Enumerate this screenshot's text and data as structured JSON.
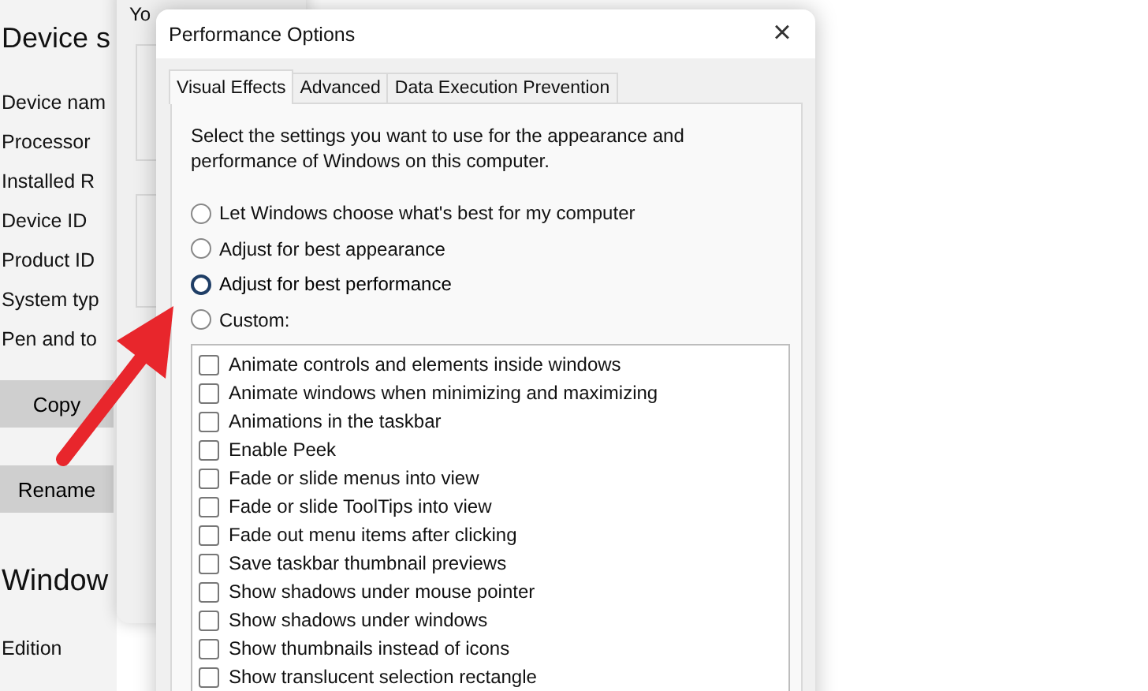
{
  "settings_page": {
    "heading": "Device s",
    "rows": [
      "Device nam",
      "Processor",
      "Installed R",
      "Device ID",
      "Product ID",
      "System typ",
      "Pen and to"
    ],
    "buttons": [
      "Copy",
      "Rename"
    ],
    "section_heading": "Window",
    "section_rows": [
      "Edition"
    ]
  },
  "background_dialog": {
    "intro": "Yo"
  },
  "dialog": {
    "title": "Performance Options",
    "close": "×",
    "tabs": [
      {
        "label": "Visual Effects",
        "selected": true
      },
      {
        "label": "Advanced",
        "selected": false
      },
      {
        "label": "Data Execution Prevention",
        "selected": false
      }
    ],
    "description": "Select the settings you want to use for the appearance and performance of Windows on this computer.",
    "options": [
      {
        "label": "Let Windows choose what's best for my computer",
        "selected": false,
        "focused": false
      },
      {
        "label": "Adjust for best appearance",
        "selected": false,
        "focused": false
      },
      {
        "label": "Adjust for best performance",
        "selected": false,
        "focused": true
      },
      {
        "label": "Custom:",
        "selected": false,
        "focused": false
      }
    ],
    "effects": [
      {
        "label": "Animate controls and elements inside windows",
        "checked": false
      },
      {
        "label": "Animate windows when minimizing and maximizing",
        "checked": false
      },
      {
        "label": "Animations in the taskbar",
        "checked": false
      },
      {
        "label": "Enable Peek",
        "checked": false
      },
      {
        "label": "Fade or slide menus into view",
        "checked": false
      },
      {
        "label": "Fade or slide ToolTips into view",
        "checked": false
      },
      {
        "label": "Fade out menu items after clicking",
        "checked": false
      },
      {
        "label": "Save taskbar thumbnail previews",
        "checked": false
      },
      {
        "label": "Show shadows under mouse pointer",
        "checked": false
      },
      {
        "label": "Show shadows under windows",
        "checked": false
      },
      {
        "label": "Show thumbnails instead of icons",
        "checked": false
      },
      {
        "label": "Show translucent selection rectangle",
        "checked": false
      }
    ]
  },
  "annotation": {
    "kind": "arrow"
  }
}
